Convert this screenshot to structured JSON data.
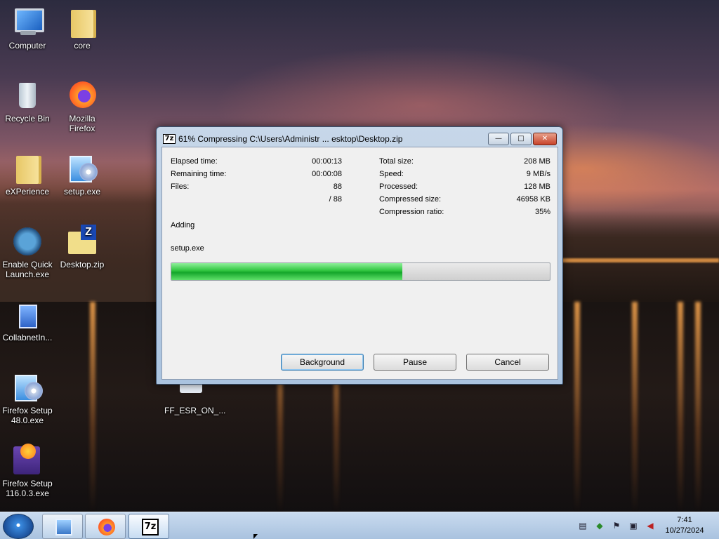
{
  "desktop": {
    "icons": [
      {
        "label": "Computer"
      },
      {
        "label": "core"
      },
      {
        "label": "Recycle Bin"
      },
      {
        "label": "Mozilla Firefox"
      },
      {
        "label": "eXPerience"
      },
      {
        "label": "setup.exe"
      },
      {
        "label": "Enable Quick Launch.exe"
      },
      {
        "label": "Desktop.zip"
      },
      {
        "label": "CollabnetIn..."
      },
      {
        "label": "Firefox Setup 48.0.exe"
      },
      {
        "label": "FF_ESR_ON_..."
      },
      {
        "label": "Firefox Setup 116.0.3.exe"
      }
    ]
  },
  "dialog": {
    "icon_text": "7z",
    "title": "61% Compressing C:\\Users\\Administr ... esktop\\Desktop.zip",
    "window_buttons": {
      "min": "—",
      "max": "□",
      "close": "✕"
    },
    "left_stats": [
      {
        "label": "Elapsed time:",
        "value": "00:00:13"
      },
      {
        "label": "Remaining time:",
        "value": "00:00:08"
      },
      {
        "label": "Files:",
        "value": "88"
      },
      {
        "label": "",
        "value": "/ 88"
      }
    ],
    "right_stats": [
      {
        "label": "Total size:",
        "value": "208 MB"
      },
      {
        "label": "Speed:",
        "value": "9 MB/s"
      },
      {
        "label": "Processed:",
        "value": "128 MB"
      },
      {
        "label": "Compressed size:",
        "value": "46958 KB"
      },
      {
        "label": "Compression ratio:",
        "value": "35%"
      }
    ],
    "status": "Adding",
    "current_file": "setup.exe",
    "progress_fraction": 0.61,
    "buttons": {
      "background": "Background",
      "pause": "Pause",
      "cancel": "Cancel"
    }
  },
  "taskbar": {
    "apps": [
      {
        "name": "explorer-icon"
      },
      {
        "name": "firefox-icon"
      },
      {
        "name": "7zip-icon",
        "text": "7z"
      }
    ],
    "clock": {
      "time": "7:41",
      "date": "10/27/2024"
    }
  }
}
